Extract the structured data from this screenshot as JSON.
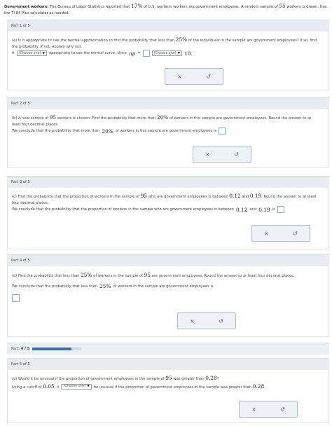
{
  "intro": {
    "bold": "Government workers:",
    "t1": " The Bureau of Labor Statistics reported that ",
    "pct": "17%",
    "t2": " of U.S. nonfarm workers are government employees. A random sample of ",
    "n": "55",
    "t3": " workers is drawn. Use the TI-84 Plus calculator as needed."
  },
  "part1": {
    "header": "Part 1 of 5",
    "q1": "(a) Is it appropriate to use the normal approximation to find the probability that less than ",
    "pct": "25%",
    "q2": " of the individuals in the sample are government employees? If so, find the probability. If not, explain why not.",
    "it": "It",
    "dd1": "(Choose one)",
    "mid": "appropriate to use the normal curve, since",
    "np": "np",
    "eq": "=",
    "dd2": "(Choose one)",
    "ten": "10."
  },
  "part2": {
    "header": "Part 2 of 5",
    "q1": "(b) A new sample of ",
    "n": "95",
    "q2": " workers is chosen. Find the probability that more than ",
    "pct": "20%",
    "q3": " of workers in this sample are government employees. Round the answer to at least four decimal places.",
    "c1": "We conclude that the probability that more than ",
    "cpct": "20%",
    "c2": " of workers in this sample are government employees is"
  },
  "part3": {
    "header": "Part 3 of 5",
    "q1": "(c) Find the probability that the proportion of workers in the sample of ",
    "n": "95",
    "q2": " who are government employees is between ",
    "a": "0.12",
    "and": " and ",
    "b": "0.19",
    "q3": ". Round the answer to at least four decimal places.",
    "c1": "We conclude that the probability that the proportion of workers in the sample who are government employees is between ",
    "ca": "0.12",
    "cand": " and ",
    "cb": "0.19",
    "c2": " is"
  },
  "part4": {
    "header": "Part 4 of 5",
    "q1": "(d) Find the probability that less than ",
    "pct": "25%",
    "q2": " of workers in the sample of ",
    "n": "95",
    "q3": " are government employees. Round the answer to at least four decimal places.",
    "c1": "We conclude that the probability that less than ",
    "cpct": "25%",
    "c2": " of workers in the sample are government employees is"
  },
  "progress": {
    "label": "Part: ",
    "value": "4 / 5",
    "fraction": 0.8,
    "color": "#3b6fb0"
  },
  "part5": {
    "header": "Part 5 of 5",
    "q1": "(e) Would it be unusual if the proportion of government employees in the sample of ",
    "n": "95",
    "q2": " was greater than ",
    "v": "0.28",
    "q3": "?",
    "c1": "Using a cutoff of ",
    "cut": "0.05",
    "c2": ", it",
    "dd": "(Choose one)",
    "c3": "be unusual if the proportion of government employees in the sample was greater than ",
    "cv": "0.28",
    "c4": "."
  },
  "icons": {
    "clear": "×",
    "undo": "↺"
  }
}
